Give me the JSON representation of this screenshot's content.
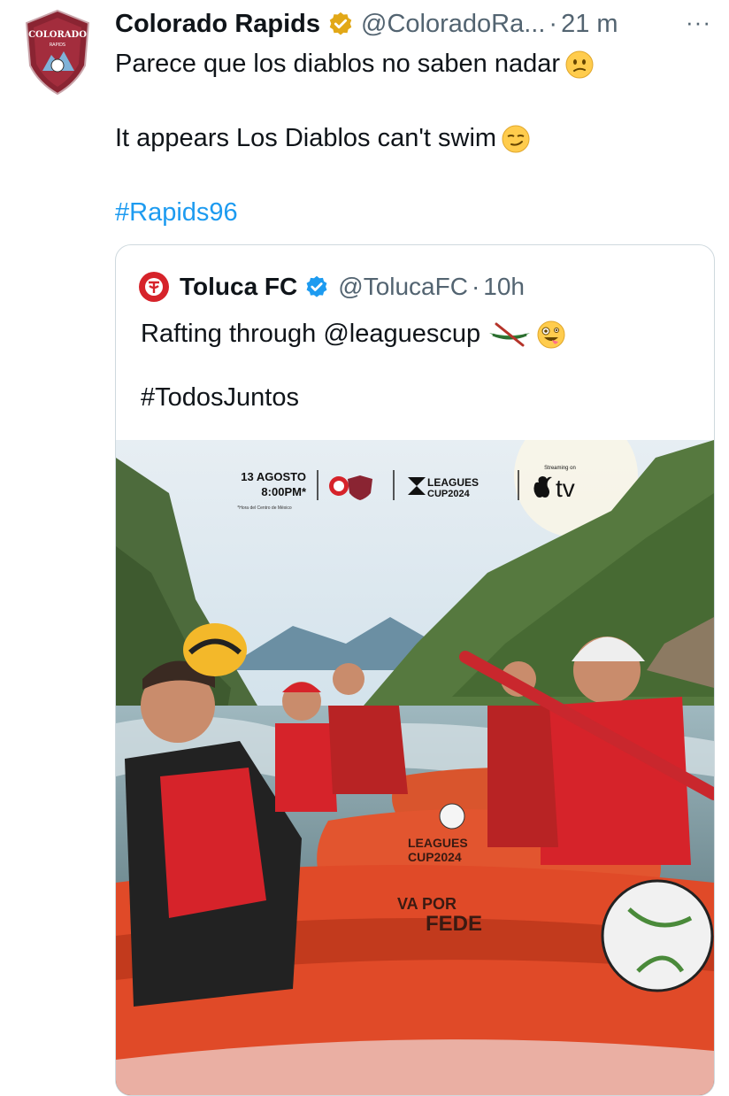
{
  "tweet": {
    "author_name": "Colorado Rapids",
    "handle": "@ColoradoRa...",
    "time": "21 m",
    "more": "···",
    "text_es": "Parece que los diablos no saben nadar",
    "text_en": "It appears Los Diablos can't swim",
    "hashtag": "#Rapids96",
    "avatar_text": "COLORADO",
    "avatar_sub": "RAPIDS"
  },
  "quote": {
    "author_name": "Toluca FC",
    "handle": "@TolucaFC",
    "time": "10h",
    "text": "Rafting through @leaguescup",
    "hashtag": "#TodosJuntos"
  },
  "poster": {
    "date": "13 AGOSTO",
    "time": "8:00PM*",
    "footnote": "*Hora del Centro de México",
    "leagues_line1": "LEAGUES",
    "leagues_line2": "CUP2024",
    "streaming": "Streaming on",
    "tv": "tv",
    "raft_text1": "LEAGUES",
    "raft_text2": "CUP2024",
    "raft_text3": "VA POR",
    "raft_text4": "FEDE"
  },
  "colors": {
    "verified_gold": "#e2a817",
    "verified_blue": "#1d9bf0",
    "hashtag": "#1d9bf0",
    "muted": "#536471",
    "rapids_maroon": "#8a2432",
    "toluca_red": "#d6232a"
  }
}
